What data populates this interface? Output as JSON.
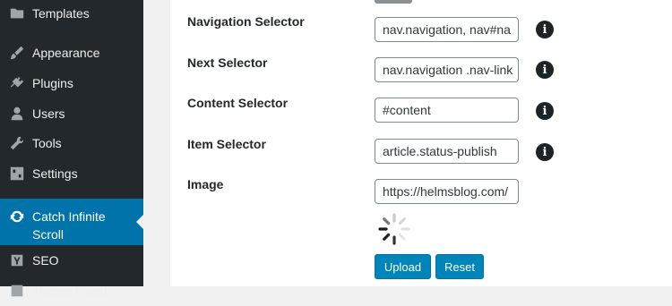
{
  "sidebar": {
    "items": [
      {
        "label": "Templates",
        "icon": "folder-icon"
      },
      {
        "label": "Appearance",
        "icon": "paintbrush-icon"
      },
      {
        "label": "Plugins",
        "icon": "plug-icon"
      },
      {
        "label": "Users",
        "icon": "user-icon"
      },
      {
        "label": "Tools",
        "icon": "wrench-icon"
      },
      {
        "label": "Settings",
        "icon": "settings-icon"
      },
      {
        "label": "Catch Infinite Scroll",
        "icon": "refresh-icon",
        "active": true
      },
      {
        "label": "SEO",
        "icon": "yoast-icon"
      },
      {
        "label": "Theme Panel",
        "icon": "theme-icon"
      }
    ]
  },
  "form": {
    "fields": [
      {
        "label": "Navigation Selector",
        "value": "nav.navigation, nav#na"
      },
      {
        "label": "Next Selector",
        "value": "nav.navigation .nav-link"
      },
      {
        "label": "Content Selector",
        "value": "#content"
      },
      {
        "label": "Item Selector",
        "value": "article.status-publish"
      },
      {
        "label": "Image",
        "value": "https://helmsblog.com/"
      }
    ],
    "info_glyph": "i",
    "upload_label": "Upload",
    "reset_label": "Reset"
  },
  "colors": {
    "sidebar_bg": "#23282d",
    "active_bg": "#0073aa",
    "button_bg": "#0085ba"
  }
}
